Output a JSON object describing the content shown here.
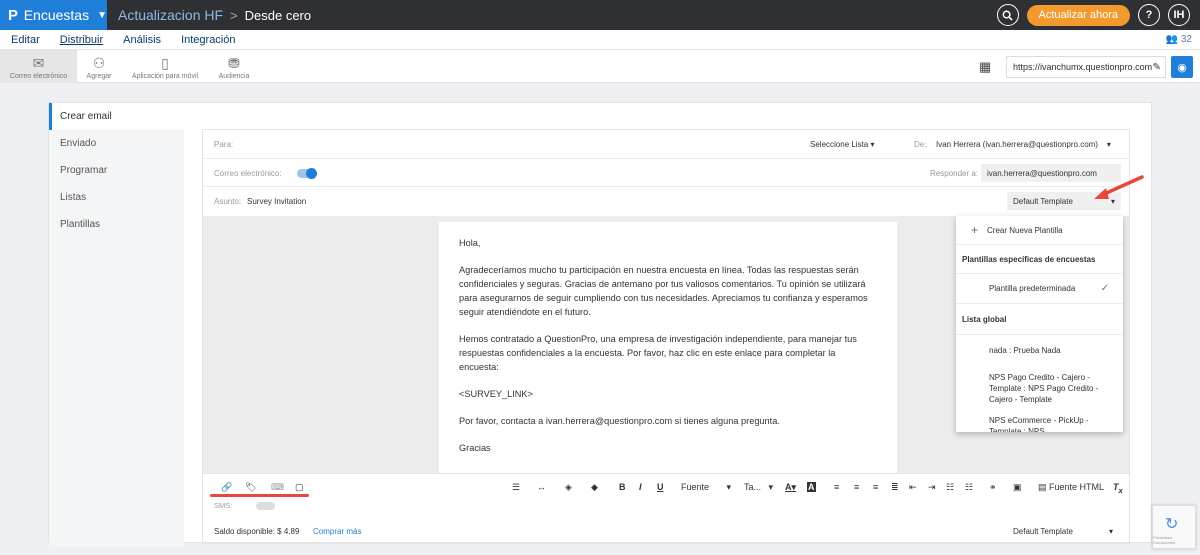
{
  "topbar": {
    "app_label": "Encuestas",
    "breadcrumb_1": "Actualizacion HF",
    "breadcrumb_sep": ">",
    "breadcrumb_2": "Desde cero",
    "update_button": "Actualizar ahora",
    "help_label": "?",
    "avatar_initials": "IH"
  },
  "menu": {
    "items": [
      "Editar",
      "Distribuir",
      "Análisis",
      "Integración"
    ],
    "active": "Distribuir",
    "user_count": "32"
  },
  "toolbar": {
    "tools": [
      "Correo electrónico",
      "Agregar",
      "Aplicación para móvil",
      "Audiencia"
    ],
    "url": "https://ivanchumx.questionpro.com"
  },
  "sidenav": {
    "items": [
      "Crear email",
      "Enviado",
      "Programar",
      "Listas",
      "Plantillas"
    ]
  },
  "form": {
    "to_label": "Para:",
    "select_list": "Seleccione Lista",
    "from_label": "De:",
    "from_value": "Ivan Herrera (ivan.herrera@questionpro.com)",
    "email_label": "Correo electrónico:",
    "reply_label": "Responder a:",
    "reply_value": "ivan.herrera@questionpro.com",
    "subject_label": "Asunto:",
    "subject_value": "Survey Invitation",
    "template_value": "Default Template"
  },
  "email_body": {
    "greeting": "Hola,",
    "para1": "Agradeceríamos mucho tu participación en nuestra encuesta en línea. Todas las respuestas serán confidenciales y seguras. Gracias de antemano por tus valiosos comentarios. Tu opinión se utilizará para asegurarnos de seguir cumpliendo con tus necesidades. Apreciamos tu confianza y esperamos seguir atendiéndote en el futuro.",
    "para2": "Hemos contratado a QuestionPro, una empresa de investigación independiente, para manejar tus respuestas confidenciales a la encuesta. Por favor, haz clic en este enlace para completar la encuesta:",
    "link": "<SURVEY_LINK>",
    "contact": "Por favor, contacta a ivan.herrera@questionpro.com si tienes alguna pregunta.",
    "closing": "Gracias"
  },
  "dropdown": {
    "create": "Crear Nueva Plantilla",
    "section1": "Plantillas específicas de encuestas",
    "default_item": "Plantilla predeterminada",
    "section2": "Lista global",
    "items": [
      "nada  : Prueba Nada",
      "NPS Pago Credito - Cajero - Template  : NPS Pago Credito - Cajero - Template",
      "NPS eCommerce - PickUp - Template  : NPS"
    ]
  },
  "editor": {
    "font_label": "Fuente",
    "size_label": "Ta...",
    "html_label": "Fuente HTML",
    "sms_label": "SMS:"
  },
  "footer": {
    "balance": "Saldo disponible: $ 4.89",
    "buy_more": "Comprar más",
    "template_value": "Default Template"
  },
  "recaptcha": {
    "text": "Privacidad - Condiciones"
  },
  "colors": {
    "brand": "#1f7fd8",
    "topbar": "#2f3033",
    "update": "#f29a2e",
    "annotation": "#e8483b"
  }
}
